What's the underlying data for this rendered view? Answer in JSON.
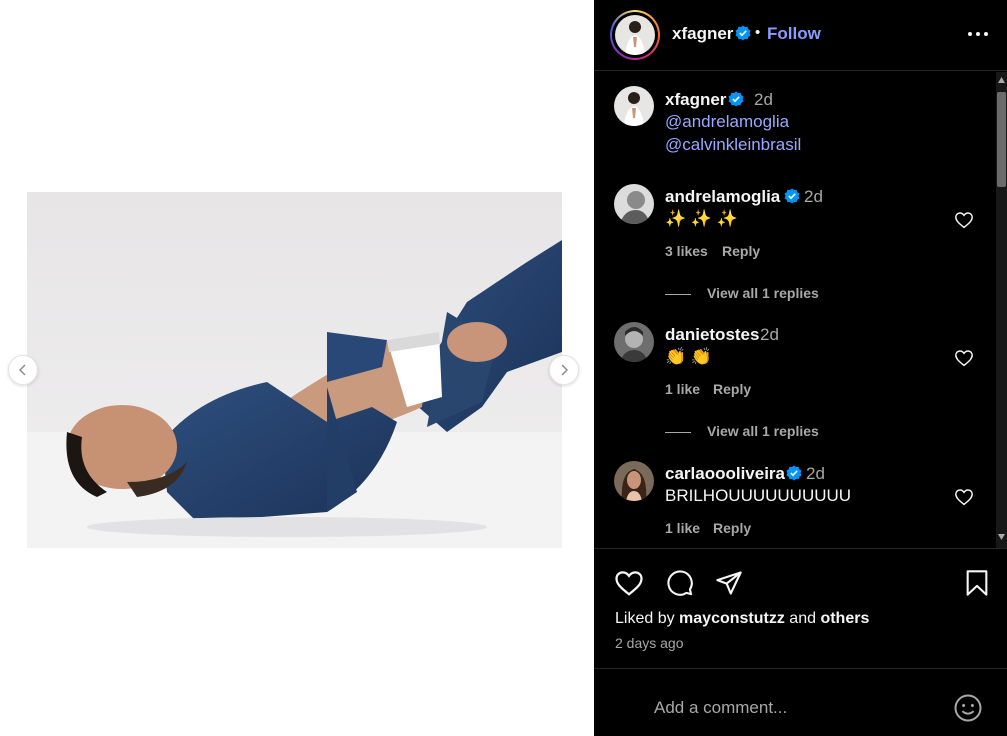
{
  "header": {
    "username": "xfagner",
    "separator": "•",
    "follow_label": "Follow"
  },
  "caption": {
    "username": "xfagner",
    "time": "2d",
    "mentions": [
      "@andrelamoglia",
      "@calvinkleinbrasil"
    ]
  },
  "comments": [
    {
      "username": "andrelamoglia",
      "verified": true,
      "time": "2d",
      "text": "✨ ✨ ✨",
      "likes": "3 likes",
      "reply_label": "Reply",
      "view_replies": "View all 1 replies"
    },
    {
      "username": "danietostes",
      "verified": false,
      "time": "2d",
      "text": "👏 👏",
      "likes": "1 like",
      "reply_label": "Reply",
      "view_replies": "View all 1 replies"
    },
    {
      "username": "carlaoooliveira",
      "verified": true,
      "time": "2d",
      "text": "BRILHOUUUUUUUUUU",
      "likes": "1 like",
      "reply_label": "Reply"
    }
  ],
  "likes": {
    "prefix": "Liked by",
    "user": "mayconstutzz",
    "conjunction": "and",
    "others": "others"
  },
  "post_date": "2 days ago",
  "comment_input": {
    "placeholder": "Add a comment..."
  },
  "icons": {
    "verified": "verified-badge-icon",
    "more": "more-options-icon",
    "like": "heart-icon",
    "comment": "comment-icon",
    "share": "share-icon",
    "save": "bookmark-icon",
    "emoji": "emoji-icon",
    "prev": "chevron-left-icon",
    "next": "chevron-right-icon"
  },
  "colors": {
    "panel_bg": "#000000",
    "follow": "#8a9cff",
    "mention": "#9aa8ff",
    "verified": "#0095f6",
    "muted": "#a8a8a8"
  }
}
